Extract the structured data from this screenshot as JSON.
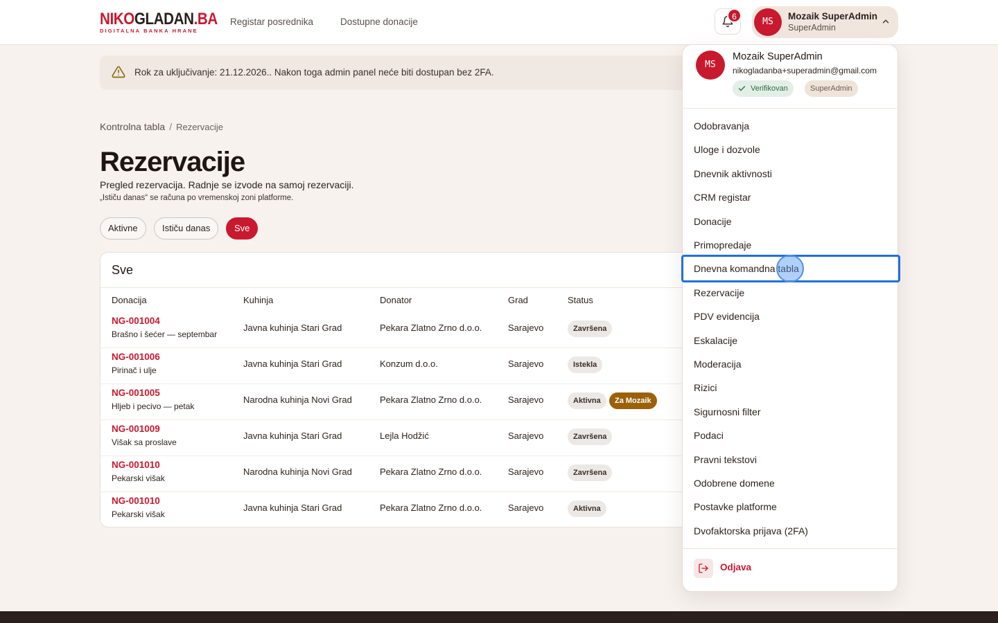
{
  "brand": {
    "logo_part1": "NIKO",
    "logo_part2": "GLADAN",
    "logo_part3": ".BA",
    "tagline": "DIGITALNA BANKA HRANE",
    "accent": "#c8192f"
  },
  "nav": {
    "links": [
      "Registar posrednika",
      "Dostupne donacije"
    ]
  },
  "notifications": {
    "count": "6"
  },
  "user": {
    "initials": "MS",
    "name": "Mozaik SuperAdmin",
    "role": "SuperAdmin",
    "email": "nikogladanba+superadmin@gmail.com",
    "verified_label": "Verifikovan",
    "role_badge": "SuperAdmin"
  },
  "alert": {
    "text": "Rok za uključivanje: 21.12.2026.. Nakon toga admin panel neće biti dostupan bez 2FA."
  },
  "breadcrumb": {
    "home": "Kontrolna tabla",
    "separator": "/",
    "current": "Rezervacije"
  },
  "page": {
    "title": "Rezervacije",
    "subtitle": "Pregled rezervacija. Radnje se izvode na samoj rezervaciji.",
    "note": "„Ističu danas“ se računa po vremenskoj zoni platforme."
  },
  "filters": {
    "items": [
      "Aktivne",
      "Ističu danas",
      "Sve"
    ],
    "selected": "Sve"
  },
  "table": {
    "title": "Sve",
    "columns": [
      "Donacija",
      "Kuhinja",
      "Donator",
      "Grad",
      "Status"
    ],
    "rows": [
      {
        "code": "NG-001004",
        "desc": "Brašno i šećer — septembar",
        "kitchen": "Javna kuhinja Stari Grad",
        "donor": "Pekara Zlatno Zrno d.o.o.",
        "city": "Sarajevo",
        "status": "Završena",
        "extra": ""
      },
      {
        "code": "NG-001006",
        "desc": "Pirinač i ulje",
        "kitchen": "Javna kuhinja Stari Grad",
        "donor": "Konzum d.o.o.",
        "city": "Sarajevo",
        "status": "Istekla",
        "extra": ""
      },
      {
        "code": "NG-001005",
        "desc": "Hljeb i pecivo — petak",
        "kitchen": "Narodna kuhinja Novi Grad",
        "donor": "Pekara Zlatno Zrno d.o.o.",
        "city": "Sarajevo",
        "status": "Aktivna",
        "extra": "Za Mozaik"
      },
      {
        "code": "NG-001009",
        "desc": "Višak sa proslave",
        "kitchen": "Javna kuhinja Stari Grad",
        "donor": "Lejla Hodžić",
        "city": "Sarajevo",
        "status": "Završena",
        "extra": ""
      },
      {
        "code": "NG-001010",
        "desc": "Pekarski višak",
        "kitchen": "Narodna kuhinja Novi Grad",
        "donor": "Pekara Zlatno Zrno d.o.o.",
        "city": "Sarajevo",
        "status": "Završena",
        "extra": ""
      },
      {
        "code": "NG-001010",
        "desc": "Pekarski višak",
        "kitchen": "Javna kuhinja Stari Grad",
        "donor": "Pekara Zlatno Zrno d.o.o.",
        "city": "Sarajevo",
        "status": "Aktivna",
        "extra": ""
      }
    ]
  },
  "menu": {
    "items": [
      "Odobravanja",
      "Uloge i dozvole",
      "Dnevnik aktivnosti",
      "CRM registar",
      "Donacije",
      "Primopredaje",
      "Dnevna komandna tabla",
      "Rezervacije",
      "PDV evidencija",
      "Eskalacije",
      "Moderacija",
      "Rizici",
      "Sigurnosni filter",
      "Podaci",
      "Pravni tekstovi",
      "Odobrene domene",
      "Postavke platforme",
      "Dvofaktorska prijava (2FA)"
    ],
    "focused": "Dnevna komandna tabla",
    "logout": "Odjava"
  }
}
